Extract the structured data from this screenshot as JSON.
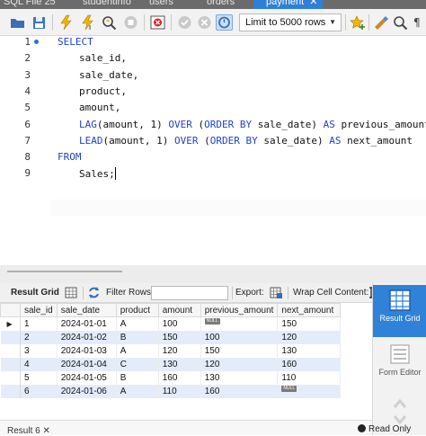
{
  "tabs": [
    {
      "label": "SQL File 25"
    },
    {
      "label": "studentinfo"
    },
    {
      "label": "users"
    },
    {
      "label": "orders"
    },
    {
      "label": "payment",
      "active": true
    }
  ],
  "toolbar": {
    "limit_label": "Limit to 5000 rows",
    "icons": [
      "folder-open-icon",
      "save-icon",
      "execute-icon",
      "execute-current-icon",
      "explain-icon",
      "stop-icon",
      "toggle-error-icon",
      "commit-icon",
      "rollback-icon",
      "autocommit-icon",
      "add-snippet-icon",
      "beautify-icon",
      "find-icon",
      "invisible-chars-icon"
    ]
  },
  "editor": {
    "lines": [
      {
        "num": "1",
        "text": "SELECT"
      },
      {
        "num": "2",
        "text": "sale_id,"
      },
      {
        "num": "3",
        "text": "sale_date,"
      },
      {
        "num": "4",
        "text": "product,"
      },
      {
        "num": "5",
        "text": "amount,"
      },
      {
        "num": "6",
        "text": "LAG(amount, 1) OVER (ORDER BY sale_date) AS previous_amount,"
      },
      {
        "num": "7",
        "text": "LEAD(amount, 1) OVER (ORDER BY sale_date) AS next_amount"
      },
      {
        "num": "8",
        "text": "FROM"
      },
      {
        "num": "9",
        "text": "Sales;"
      }
    ]
  },
  "result_toolbar": {
    "result_grid_label": "Result Grid",
    "filter_rows_label": "Filter Rows:",
    "export_label": "Export:",
    "wrap_label": "Wrap Cell Content:"
  },
  "grid": {
    "columns": [
      "sale_id",
      "sale_date",
      "product",
      "amount",
      "previous_amount",
      "next_amount"
    ],
    "null_label": "NULL",
    "rows": [
      {
        "sale_id": "1",
        "sale_date": "2024-01-01",
        "product": "A",
        "amount": "100",
        "previous_amount": "",
        "next_amount": "150"
      },
      {
        "sale_id": "2",
        "sale_date": "2024-01-02",
        "product": "B",
        "amount": "150",
        "previous_amount": "100",
        "next_amount": "120"
      },
      {
        "sale_id": "3",
        "sale_date": "2024-01-03",
        "product": "A",
        "amount": "120",
        "previous_amount": "150",
        "next_amount": "130"
      },
      {
        "sale_id": "4",
        "sale_date": "2024-01-04",
        "product": "C",
        "amount": "130",
        "previous_amount": "120",
        "next_amount": "160"
      },
      {
        "sale_id": "5",
        "sale_date": "2024-01-05",
        "product": "B",
        "amount": "160",
        "previous_amount": "130",
        "next_amount": "110"
      },
      {
        "sale_id": "6",
        "sale_date": "2024-01-06",
        "product": "A",
        "amount": "110",
        "previous_amount": "160",
        "next_amount": ""
      }
    ]
  },
  "side_panel": {
    "result_grid_label": "Result Grid",
    "form_editor_label": "Form Editor"
  },
  "bottom": {
    "result_tab_label": "Result 6",
    "read_only_label": "Read Only"
  },
  "colors": {
    "accent": "#2f82d8",
    "keyword": "#1f3fd6",
    "row_alt": "#e4ecf9"
  }
}
